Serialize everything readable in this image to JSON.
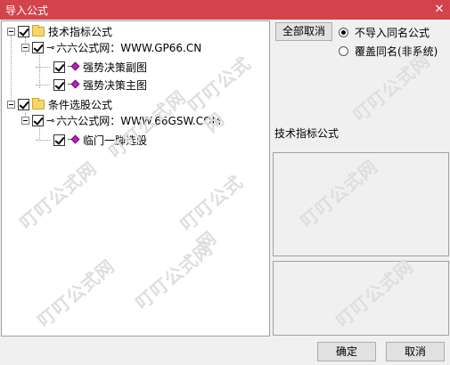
{
  "window": {
    "title": "导入公式",
    "close_glyph": "✕"
  },
  "tree": {
    "root1": {
      "label": "技术指标公式",
      "source": {
        "label": "六六公式网：WWW.GP66.CN",
        "items": [
          "强势决策副图",
          "强势决策主图"
        ]
      }
    },
    "root2": {
      "label": "条件选股公式",
      "source": {
        "label": "六六公式网：WWW.66GSW.COM",
        "items": [
          "临门一脚选股"
        ]
      }
    }
  },
  "options": {
    "cancel_all_label": "全部取消",
    "radio_skip": "不导入同名公式",
    "radio_overwrite": "覆盖同名(非系统)",
    "selected": "skip"
  },
  "detail": {
    "section_title": "技术指标公式"
  },
  "footer": {
    "ok_label": "确定",
    "cancel_label": "取消"
  },
  "watermark": {
    "text": "叮叮公式网"
  },
  "colors": {
    "titlebar": "#d2434c",
    "diamond": "#c21dc2",
    "folder": "#f7d66a"
  }
}
